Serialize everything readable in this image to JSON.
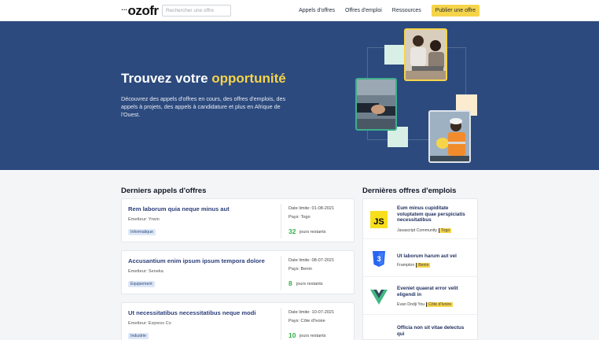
{
  "header": {
    "logo_dots": "…",
    "logo_text": "ozofr",
    "search_placeholder": "Rechercher une offre",
    "nav": [
      "Appels d'offres",
      "Offres d'emploi",
      "Ressources"
    ],
    "cta": "Publier une offre"
  },
  "hero": {
    "title_main": "Trouvez votre ",
    "title_accent": "opportunité",
    "description": "Découvrez des appels d'offres en cours, des offres d'emplois, des appels à projets, des appels à candidature et plus en Afrique de l'Ouest."
  },
  "tenders": {
    "heading": "Derniers appels d'offres",
    "items": [
      {
        "title": "Rem laborum quia neque minus aut",
        "emitter": "Emetteur: Yrwin",
        "category": "Informatique",
        "deadline": "Date limite: 01-08-2021",
        "country": "Pays: Togo",
        "days": "32",
        "days_label": "jours restants"
      },
      {
        "title": "Accusantium enim ipsum ipsum tempora dolore",
        "emitter": "Emetteur: Seneka",
        "category": "Equipement",
        "deadline": "Date limite: 08-07-2021",
        "country": "Pays: Benin",
        "days": "8",
        "days_label": "jours restants"
      },
      {
        "title": "Ut necessitatibus necessitatibus neque modi",
        "emitter": "Emetteur: Express Co",
        "category": "Industrie",
        "deadline": "Date limite: 10-07-2021",
        "country": "Pays: Côte d'Ivoire",
        "days": "10",
        "days_label": "jours restants"
      }
    ]
  },
  "jobs": {
    "heading": "Dernières offres d'emplois",
    "items": [
      {
        "title": "Eum minus cupiditate voluptatem quae perspiciatis necessitatibus",
        "company": "Javascript Community",
        "location": "Togo",
        "icon": "javascript-icon"
      },
      {
        "title": "Ut laborum harum aut vel",
        "company": "Frampton",
        "location": "Benin",
        "icon": "css3-icon"
      },
      {
        "title": "Eveniet quaerat error velit eligendi in",
        "company": "Evan Dodji You",
        "location": "Côte d'Ivoire",
        "icon": "vue-icon"
      },
      {
        "title": "Officia non sit vitae delectus qui",
        "company": "",
        "location": "",
        "icon": "none"
      }
    ]
  },
  "colors": {
    "accent": "#f6d44a",
    "hero_bg": "#2c4a7e",
    "success": "#2fb344"
  }
}
